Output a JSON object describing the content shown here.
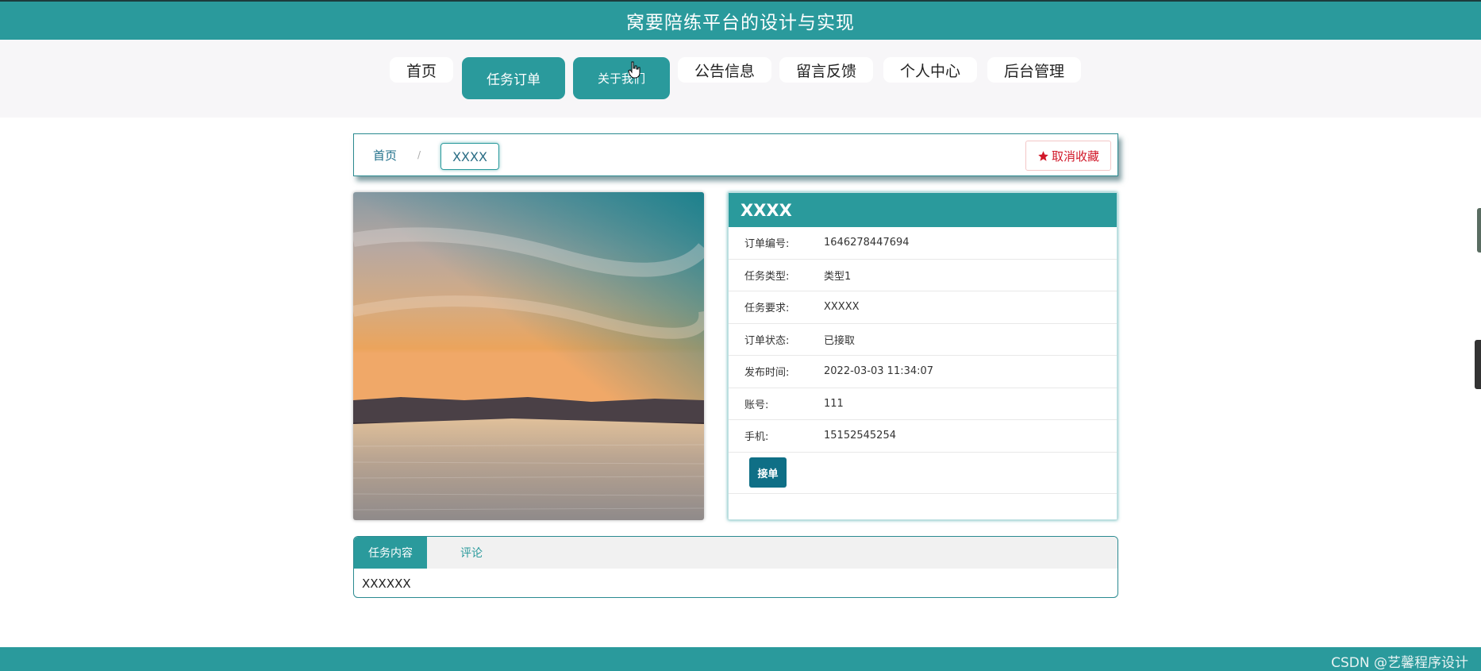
{
  "header": {
    "title": "窝要陪练平台的设计与实现"
  },
  "nav": {
    "items": [
      {
        "label": "首页"
      },
      {
        "label": "任务订单"
      },
      {
        "label": "关于我们"
      },
      {
        "label": "公告信息"
      },
      {
        "label": "留言反馈"
      },
      {
        "label": "个人中心"
      },
      {
        "label": "后台管理"
      }
    ]
  },
  "breadcrumb": {
    "home": "首页",
    "separator": "/",
    "current": "XXXX"
  },
  "favorite": {
    "label": "取消收藏",
    "icon": "star-icon",
    "color": "#d1192a"
  },
  "detail": {
    "title": "XXXX",
    "rows": [
      {
        "label": "订单编号:",
        "value": "1646278447694"
      },
      {
        "label": "任务类型:",
        "value": "类型1"
      },
      {
        "label": "任务要求:",
        "value": "XXXXX"
      },
      {
        "label": "订单状态:",
        "value": "已接取"
      },
      {
        "label": "发布时间:",
        "value": "2022-03-03 11:34:07"
      },
      {
        "label": "账号:",
        "value": "111"
      },
      {
        "label": "手机:",
        "value": "15152545254"
      }
    ],
    "accept_label": "接单"
  },
  "tabs": {
    "items": [
      {
        "label": "任务内容"
      },
      {
        "label": "评论"
      }
    ],
    "content": "XXXXXX"
  },
  "footer": {
    "watermark": "CSDN @艺馨程序设计"
  },
  "colors": {
    "accent": "#2a9a9c",
    "button_dark": "#0f6f86"
  }
}
